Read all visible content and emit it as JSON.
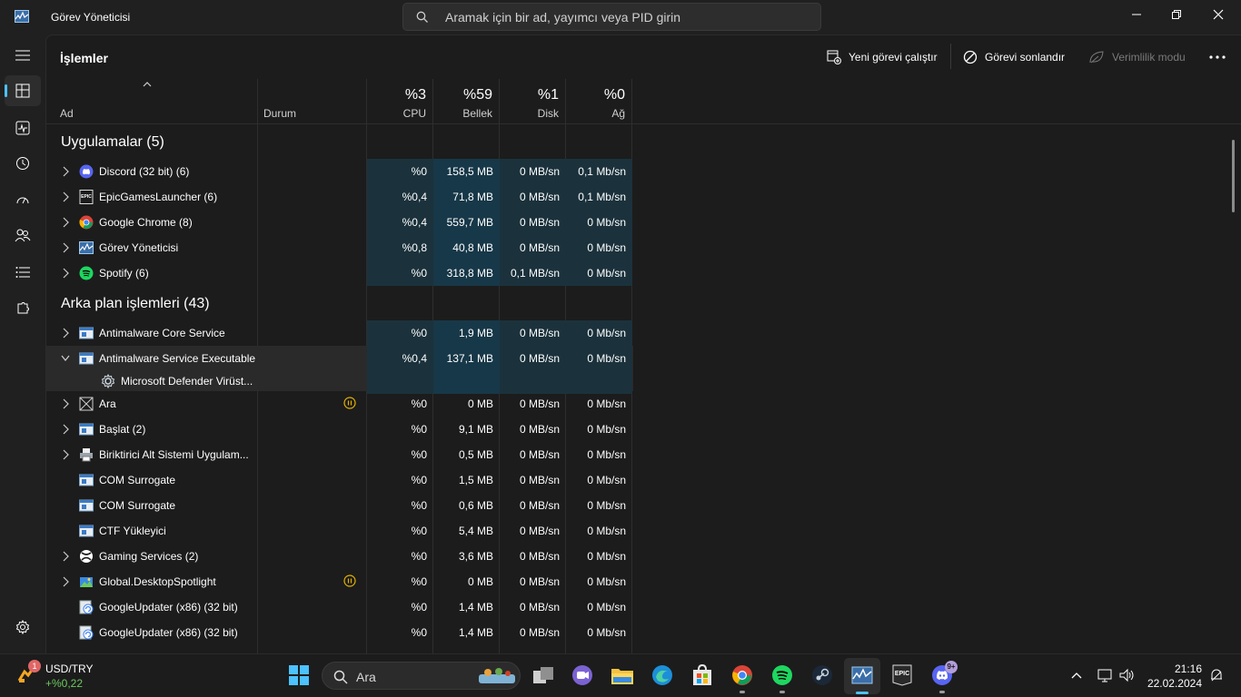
{
  "window": {
    "title": "Görev Yöneticisi",
    "search_placeholder": "Aramak için bir ad, yayımcı veya PID girin"
  },
  "toolbar": {
    "page_title": "İşlemler",
    "run_new_task": "Yeni görevi çalıştır",
    "end_task": "Görevi sonlandır",
    "efficiency_mode": "Verimlilik modu",
    "more": "..."
  },
  "columns": {
    "name": "Ad",
    "status": "Durum",
    "cpu": {
      "pct": "%3",
      "label": "CPU"
    },
    "memory": {
      "pct": "%59",
      "label": "Bellek"
    },
    "disk": {
      "pct": "%1",
      "label": "Disk"
    },
    "network": {
      "pct": "%0",
      "label": "Ağ"
    }
  },
  "groups": {
    "apps": "Uygulamalar (5)",
    "background": "Arka plan işlemleri (43)"
  },
  "apps": [
    {
      "name": "Discord (32 bit) (6)",
      "cpu": "%0",
      "mem": "158,5 MB",
      "disk": "0 MB/sn",
      "net": "0,1 Mb/sn",
      "icon": "discord-icon"
    },
    {
      "name": "EpicGamesLauncher (6)",
      "cpu": "%0,4",
      "mem": "71,8 MB",
      "disk": "0 MB/sn",
      "net": "0,1 Mb/sn",
      "icon": "epic-icon"
    },
    {
      "name": "Google Chrome (8)",
      "cpu": "%0,4",
      "mem": "559,7 MB",
      "disk": "0 MB/sn",
      "net": "0 Mb/sn",
      "icon": "chrome-icon"
    },
    {
      "name": "Görev Yöneticisi",
      "cpu": "%0,8",
      "mem": "40,8 MB",
      "disk": "0 MB/sn",
      "net": "0 Mb/sn",
      "icon": "task-manager-icon"
    },
    {
      "name": "Spotify (6)",
      "cpu": "%0",
      "mem": "318,8 MB",
      "disk": "0,1 MB/sn",
      "net": "0 Mb/sn",
      "icon": "spotify-icon"
    }
  ],
  "background": [
    {
      "name": "Antimalware Core Service",
      "cpu": "%0",
      "mem": "1,9 MB",
      "disk": "0 MB/sn",
      "net": "0 Mb/sn",
      "icon": "service-window-icon"
    },
    {
      "name": "Antimalware Service Executable",
      "cpu": "%0,4",
      "mem": "137,1 MB",
      "disk": "0 MB/sn",
      "net": "0 Mb/sn",
      "icon": "service-window-icon"
    },
    {
      "name": "Microsoft Defender Virüst...",
      "icon": "gear-service-icon"
    },
    {
      "name": "Ara",
      "cpu": "%0",
      "mem": "0 MB",
      "disk": "0 MB/sn",
      "net": "0 Mb/sn",
      "icon": "suspended-app-icon"
    },
    {
      "name": "Başlat (2)",
      "cpu": "%0",
      "mem": "9,1 MB",
      "disk": "0 MB/sn",
      "net": "0 Mb/sn",
      "icon": "service-window-icon"
    },
    {
      "name": "Biriktirici Alt Sistemi Uygulam...",
      "cpu": "%0",
      "mem": "0,5 MB",
      "disk": "0 MB/sn",
      "net": "0 Mb/sn",
      "icon": "printer-icon"
    },
    {
      "name": "COM Surrogate",
      "cpu": "%0",
      "mem": "1,5 MB",
      "disk": "0 MB/sn",
      "net": "0 Mb/sn",
      "icon": "service-window-icon"
    },
    {
      "name": "COM Surrogate",
      "cpu": "%0",
      "mem": "0,6 MB",
      "disk": "0 MB/sn",
      "net": "0 Mb/sn",
      "icon": "service-window-icon"
    },
    {
      "name": "CTF Yükleyici",
      "cpu": "%0",
      "mem": "5,4 MB",
      "disk": "0 MB/sn",
      "net": "0 Mb/sn",
      "icon": "service-window-icon"
    },
    {
      "name": "Gaming Services (2)",
      "cpu": "%0",
      "mem": "3,6 MB",
      "disk": "0 MB/sn",
      "net": "0 Mb/sn",
      "icon": "xbox-icon"
    },
    {
      "name": "Global.DesktopSpotlight",
      "cpu": "%0",
      "mem": "0 MB",
      "disk": "0 MB/sn",
      "net": "0 Mb/sn",
      "icon": "spotlight-icon"
    },
    {
      "name": "GoogleUpdater (x86) (32 bit)",
      "cpu": "%0",
      "mem": "1,4 MB",
      "disk": "0 MB/sn",
      "net": "0 Mb/sn",
      "icon": "updater-icon"
    },
    {
      "name": "GoogleUpdater (x86) (32 bit)",
      "cpu": "%0",
      "mem": "1,4 MB",
      "disk": "0 MB/sn",
      "net": "0 Mb/sn",
      "icon": "updater-icon"
    }
  ],
  "taskbar": {
    "widget_title": "USD/TRY",
    "widget_value": "+%0,22",
    "widget_badge": "1",
    "search_label": "Ara",
    "discord_badge": "9+",
    "time": "21:16",
    "date": "22.02.2024"
  },
  "colors": {
    "accent": "#4cc2ff",
    "cpu_heat_low": "#1f3b45",
    "mem_heat": "#173848",
    "paused_icon": "#e3b200"
  }
}
